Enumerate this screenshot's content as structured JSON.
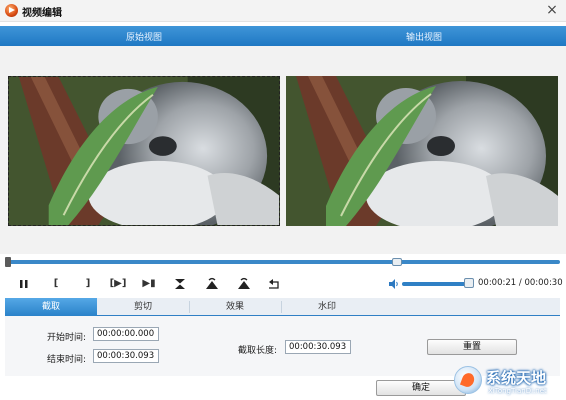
{
  "window": {
    "title": "视频编辑"
  },
  "view_header": {
    "original_label": "原始视图",
    "output_label": "输出视图"
  },
  "timeline": {
    "progress": 0.71
  },
  "controls": {
    "play_label": "⏸",
    "mark_in_label": "[",
    "mark_out_label": "]",
    "clip_label": "[▶]",
    "next_label": "▶▮",
    "icons": [
      "play-pause-icon",
      "mark-in-icon",
      "mark-out-icon",
      "play-selection-icon",
      "next-frame-icon",
      "flip-vertical-icon",
      "rotate-left-icon",
      "rotate-right-icon",
      "undo-icon",
      "volume-icon"
    ],
    "volume": 0.9,
    "time_display": "00:00:21 / 00:00:30"
  },
  "tabs": [
    {
      "label": "截取",
      "active": true
    },
    {
      "label": "剪切",
      "active": false
    },
    {
      "label": "效果",
      "active": false
    },
    {
      "label": "水印",
      "active": false
    }
  ],
  "trim": {
    "start_label": "开始时间:",
    "start_value": "00:00:00.000",
    "end_label": "结束时间:",
    "end_value": "00:00:30.093",
    "length_label": "截取长度:",
    "length_value": "00:00:30.093",
    "reset_label": "重置"
  },
  "footer": {
    "ok_label": "确定"
  },
  "logo": {
    "title": "系统天地",
    "url": "XiTongTianDi.net"
  },
  "colors": {
    "header_blue": "#2a82c9",
    "accent_blue": "#3a88c8"
  }
}
